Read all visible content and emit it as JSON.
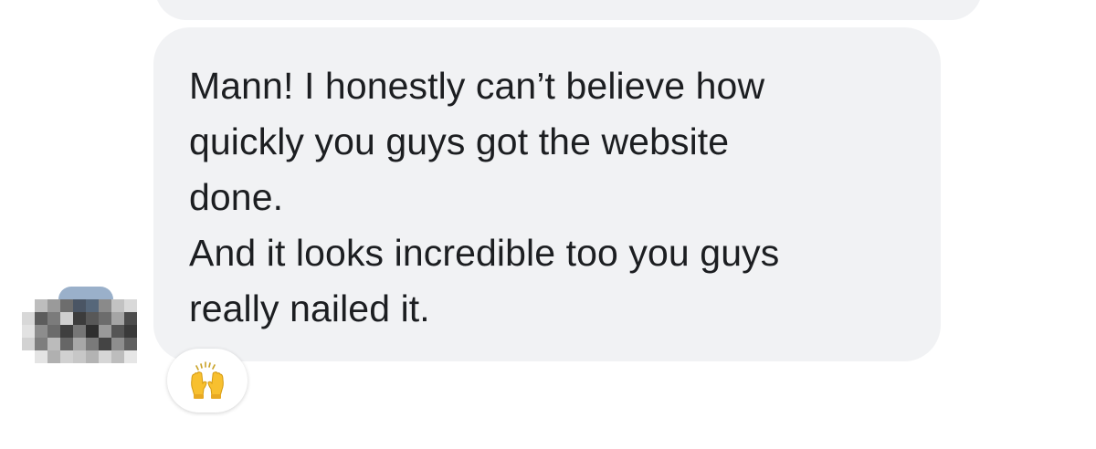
{
  "previous_message": {
    "text": ""
  },
  "message": {
    "paragraphs": [
      "Mann! I honestly can’t believe how\nquickly you guys got the website\ndone.",
      "And it looks incredible too you guys\nreally nailed it."
    ]
  },
  "reaction": {
    "emoji_icon": "raising-hands-icon"
  },
  "avatar": {
    "icon": "blurred-avatar-icon"
  },
  "colors": {
    "bubble": "#f1f2f4",
    "text": "#1c1e21",
    "reaction_bg": "#ffffff",
    "emoji_yellow": "#f8c02f"
  }
}
